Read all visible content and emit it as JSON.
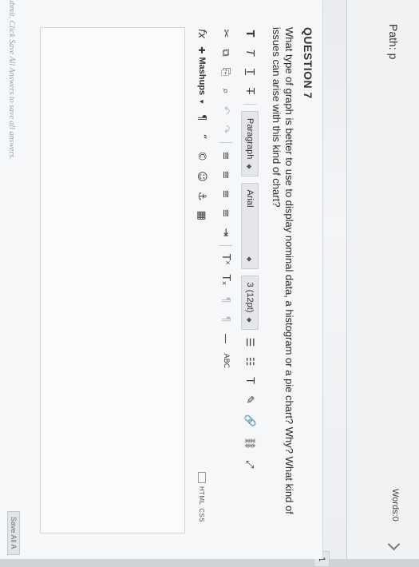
{
  "path": {
    "label": "Path: p",
    "words": "Words:0"
  },
  "question": {
    "number_tab": "1",
    "title": "QUESTION 7",
    "text": "What type of graph is better to use to display nominal data, a histogram or a pie chart? Why? What kind of issues can arise with this kind of chart?"
  },
  "toolbar": {
    "row1": {
      "bold": "T",
      "italic": "T",
      "underline": "T",
      "strike": "T",
      "paragraph": "Paragraph",
      "font": "Arial",
      "size": "3 (12pt)",
      "unordered_list": "☰",
      "ordered_list": "☷",
      "text_color": "T",
      "highlight": "✎",
      "link": "🔗",
      "unlink": "⛓",
      "fullscreen": "⤢"
    },
    "row2": {
      "cut": "✂",
      "copy": "⧉",
      "paste": "⎘",
      "find": "⌕",
      "undo": "↶",
      "redo": "↷",
      "align_left": "≡",
      "align_center": "≡",
      "align_right": "≡",
      "justify": "≡",
      "indent": "⇥",
      "superscript": "Tˣ",
      "subscript": "Tₓ",
      "ltr": "¶",
      "rtl": "¶",
      "hr": "—",
      "spell": "ABC"
    },
    "row3": {
      "formula": "fx",
      "mashups": "Mashups",
      "pilcrow": "¶",
      "quote": "“",
      "copyright": "©",
      "emoji": "☺",
      "anchor": "⚓",
      "table": "▦",
      "html": "HTML",
      "css": "CSS"
    }
  },
  "footer": {
    "note": "submit. Click Save All Answers to save all answers.",
    "save_all": "Save All A"
  }
}
